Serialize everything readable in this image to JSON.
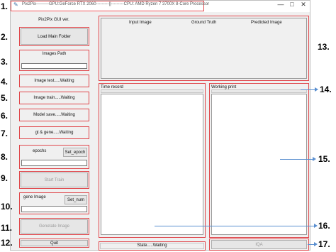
{
  "window": {
    "title": "Pix2Pix---------GPU:GeForce RTX 2060---------||---------CPU: AMD Ryzen 7 3700X 8-Core Processor",
    "controls": [
      "—",
      "□",
      "✕"
    ]
  },
  "left": {
    "gui_label": "Pix2Pix GUI ver.",
    "load_button": "Load Main Folder",
    "images_path_label": "Images Path",
    "image_test_status": "Image test.....Waiting",
    "image_train_status": "Image train.....Waiting",
    "model_save_status": "Model save.....Waiting",
    "gt_gene_status": "gt & gene.....Waiting",
    "epochs_label": "epochs",
    "set_epoch_button": "Set_epoch",
    "start_train_button": "Start Train",
    "gene_image_label": "gene Image",
    "set_num_button": "Set_num",
    "generate_button": "Genetate Image",
    "quit_button": "Quit"
  },
  "preview": {
    "headers": [
      "Input Image",
      "Ground Truth",
      "Predicted Image"
    ]
  },
  "time_record": {
    "title": "Time record"
  },
  "working_print": {
    "title": "Working print"
  },
  "state": {
    "text": "State.....Waiting"
  },
  "iqa_button": "IQA",
  "annotations": [
    "1.",
    "2.",
    "3.",
    "4.",
    "5.",
    "6.",
    "7.",
    "8.",
    "9.",
    "10.",
    "11.",
    "12.",
    "13.",
    "14.",
    "15.",
    "16.",
    "17."
  ]
}
